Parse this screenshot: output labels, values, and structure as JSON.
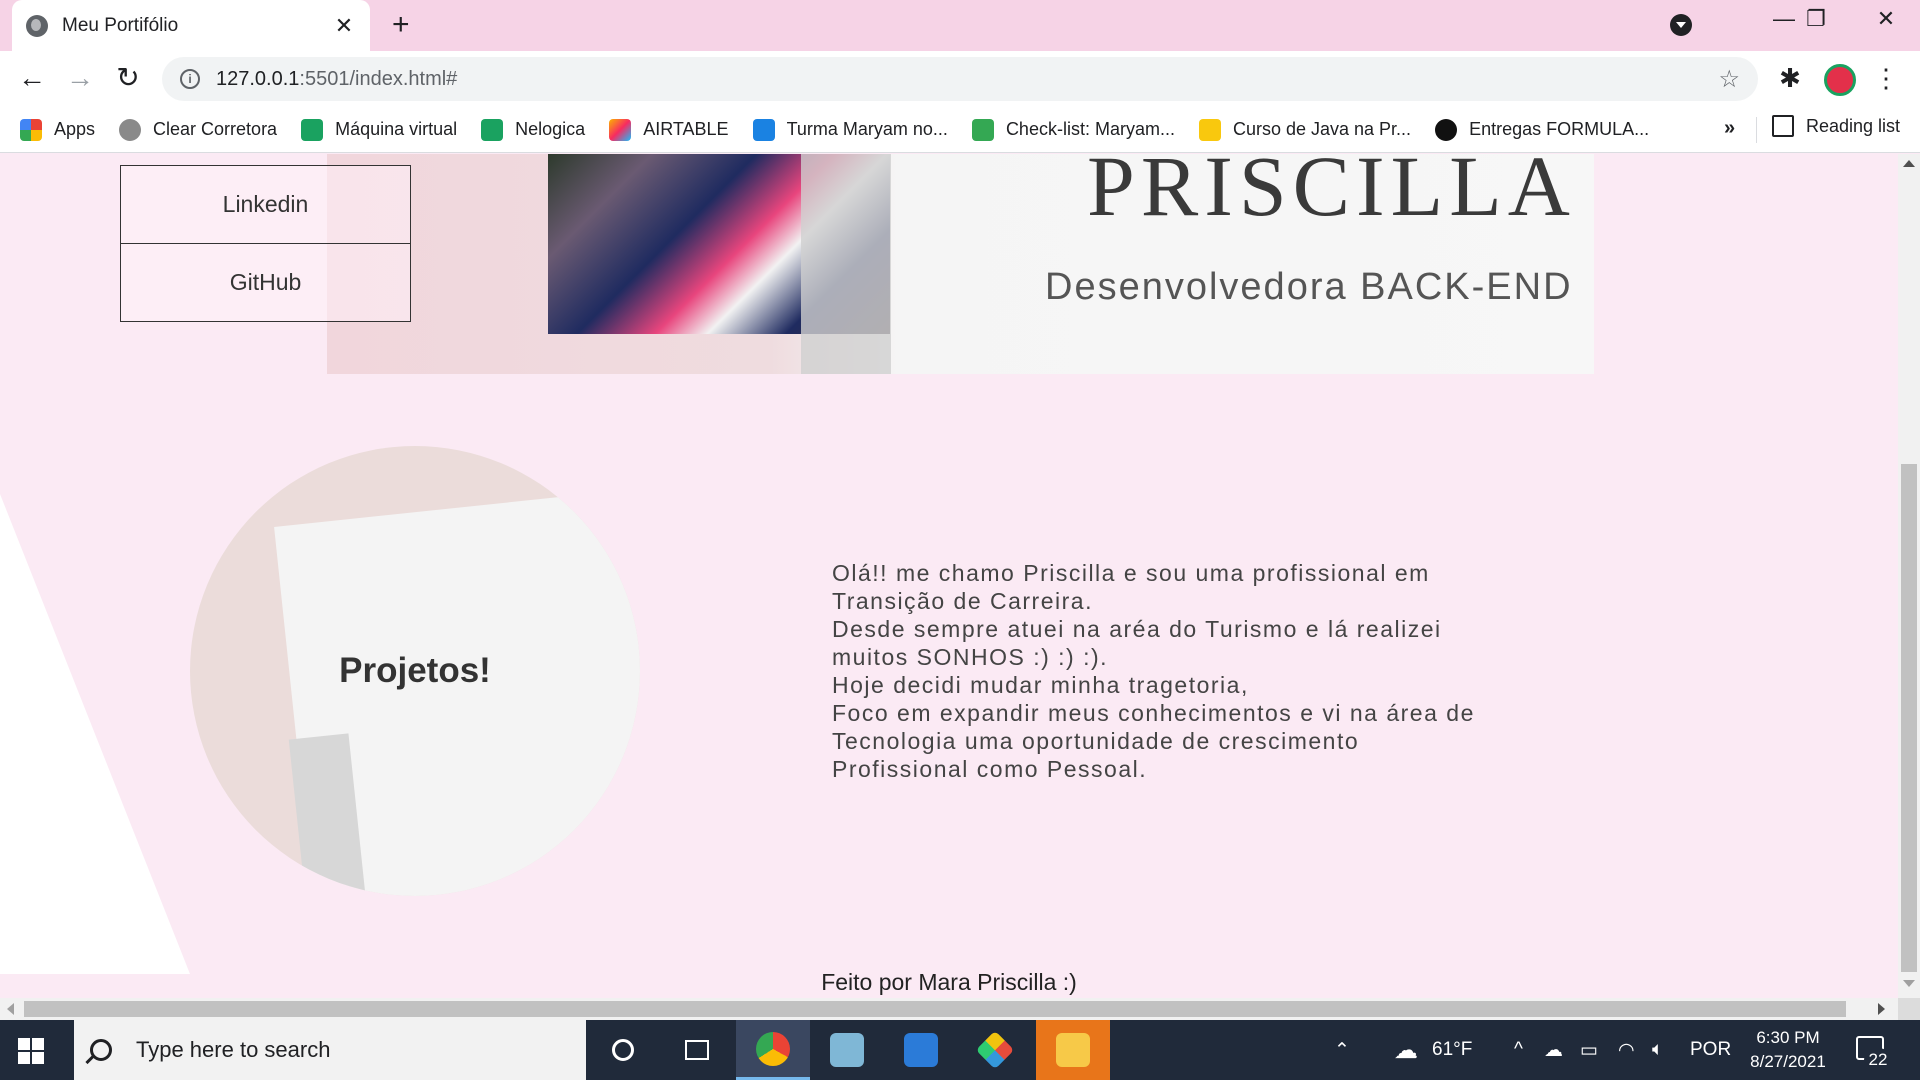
{
  "browser": {
    "tab_title": "Meu Portifólio",
    "tab_close": "✕",
    "new_tab": "+",
    "url_host": "127.0.0.1",
    "url_path": ":5501/index.html#",
    "minimize": "—",
    "restore": "❐",
    "close": "✕",
    "back": "←",
    "forward": "→",
    "reload": "↻",
    "star": "☆",
    "extensions": "✱",
    "menu": "⋮"
  },
  "bookmarks": {
    "items": [
      {
        "label": "Apps",
        "color": "#ea4335"
      },
      {
        "label": "Clear Corretora",
        "color": "#8a8a8a"
      },
      {
        "label": "Máquina virtual",
        "color": "#1aa260"
      },
      {
        "label": "Nelogica",
        "color": "#1aa260"
      },
      {
        "label": "AIRTABLE",
        "color": "#fcb400"
      },
      {
        "label": "Turma Maryam no...",
        "color": "#1a82e2"
      },
      {
        "label": "Check-list: Maryam...",
        "color": "#34a853"
      },
      {
        "label": "Curso de Java na Pr...",
        "color": "#f9c80e"
      },
      {
        "label": "Entregas FORMULA...",
        "color": "#111111"
      }
    ],
    "more": "»",
    "reading_list": "Reading list"
  },
  "page": {
    "hero_name": "PRISCILLA",
    "hero_role": "Desenvolvedora BACK-END",
    "linkedin": "Linkedin",
    "github": "GitHub",
    "projects": "Projetos!",
    "about_lines": [
      "Olá!! me chamo Priscilla e sou uma profissional em",
      "Transição de Carreira.",
      "Desde sempre atuei na aréa do Turismo e lá realizei",
      "muitos SONHOS :) :) :).",
      "Hoje decidi mudar minha tragetoria,",
      "Foco em expandir meus conhecimentos e vi na área de",
      "Tecnologia uma oportunidade de crescimento",
      "Profissional como Pessoal."
    ],
    "footer": "Feito por Mara Priscilla :)"
  },
  "taskbar": {
    "search_placeholder": "Type here to search",
    "weather": "61°F",
    "language": "POR",
    "time": "6:30 PM",
    "date": "8/27/2021",
    "notifications": "22"
  },
  "colors": {
    "page_bg": "#fbeaf4",
    "tabbar_bg": "#f6d3e6",
    "taskbar_bg": "#202a3a"
  }
}
